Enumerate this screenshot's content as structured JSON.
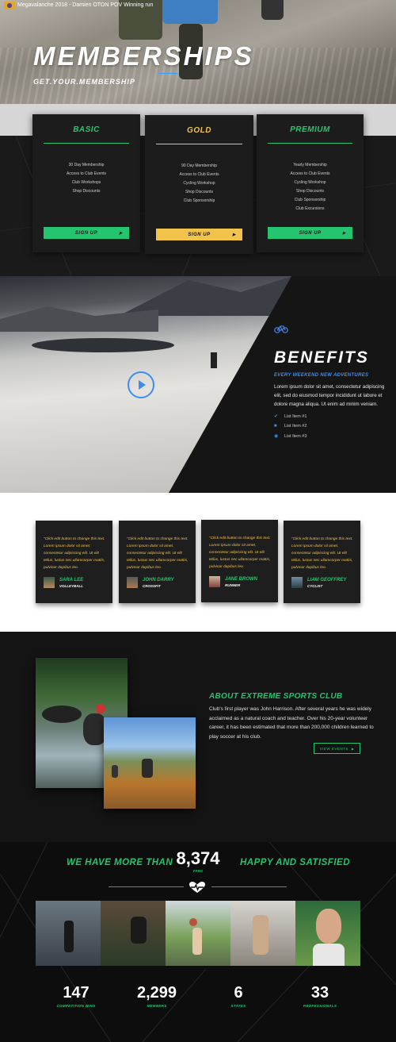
{
  "hero": {
    "title": "MEMBERSHIPS",
    "subtitle": "GET.YOUR.MEMBERSHIP"
  },
  "plans": [
    {
      "name": "BASIC",
      "color": "#25c46e",
      "features": [
        "30 Day Membership",
        "Access to Club Events",
        "Club Workshops",
        "Shop Discounts"
      ],
      "button": "SIGN UP"
    },
    {
      "name": "GOLD",
      "color": "#f2c34b",
      "features": [
        "90 Day Membership",
        "Access to Club Events",
        "Cycling Workshop",
        "Shop Discounts",
        "Club Sponsorship"
      ],
      "button": "SIGN UP"
    },
    {
      "name": "PREMIUM",
      "color": "#25c46e",
      "features": [
        "Yearly Membership",
        "Access to Club Events",
        "Cycling Workshop",
        "Shop Discounts",
        "Club Sponsorship",
        "Club Excursions"
      ],
      "button": "SIGN UP"
    }
  ],
  "video": {
    "title": "Megavalanche 2018 - Damien OTON POV Winning run"
  },
  "benefits": {
    "icon": "bicycle-icon",
    "title": "BENEFITS",
    "subtitle": "EVERY WEEKEND NEW ADVENTURES",
    "body": "Lorem ipsum dolor sit amet, consectetur adipiscing elit, sed do eiusmod tempor incididunt ut labore et dolore magna aliqua. Ut enim ad minim veniam.",
    "items": [
      {
        "label": "List Item #1",
        "icon": "check-icon"
      },
      {
        "label": "List Item #2",
        "icon": "square-icon"
      },
      {
        "label": "List Item #3",
        "icon": "circle-icon"
      }
    ]
  },
  "testimonials": [
    {
      "quote": "\"Click edit button to change this text. Lorem ipsum dolor sit amet, consectetur adipiscing elit. Ut elit tellus, luctus nec ullamcorper mattis, pulvinar dapibus leo.",
      "name": "SARA LEE",
      "role": "VOLLEYBALL"
    },
    {
      "quote": "\"Click edit button to change this text. Lorem ipsum dolor sit amet, consectetur adipiscing elit. Ut elit tellus, luctus nec ullamcorper mattis, pulvinar dapibus leo.",
      "name": "JOHN DARRY",
      "role": "CROSSFIT"
    },
    {
      "quote": "\"Click edit button to change this text. Lorem ipsum dolor sit amet, consectetur adipiscing elit. Ut elit tellus, luctus nec ullamcorper mattis, pulvinar dapibus leo.",
      "name": "JANE BROWN",
      "role": "RUNNER"
    },
    {
      "quote": "\"Click edit button to change this text. Lorem ipsum dolor sit amet, consectetur adipiscing elit. Ut elit tellus, luctus nec ullamcorper mattis, pulvinar dapibus leo.",
      "name": "LIAM GEOFFREY",
      "role": "CYCLIST"
    }
  ],
  "about": {
    "title": "ABOUT EXTREME SPORTS CLUB",
    "body": "Club's first player was John Harrison. After several years he was widely acclaimed as a natural coach and teacher. Over his 20-year volunteer career, it has been estimated that more than 200,000 children learned to play soccer at his club.",
    "button": "VIEW EVENTS"
  },
  "fans": {
    "left": "WE HAVE MORE THAN",
    "number": "8,374",
    "label": "FANS",
    "right": "HAPPY AND SATISFIED"
  },
  "stats": [
    {
      "number": "147",
      "label": "COMPETITION WINS"
    },
    {
      "number": "2,299",
      "label": "MEMBERS"
    },
    {
      "number": "6",
      "label": "STATES"
    },
    {
      "number": "33",
      "label": "PROFESSIONALS"
    }
  ],
  "colors": {
    "green": "#25c46e",
    "gold": "#f2c34b",
    "blue": "#3f8cf0"
  }
}
